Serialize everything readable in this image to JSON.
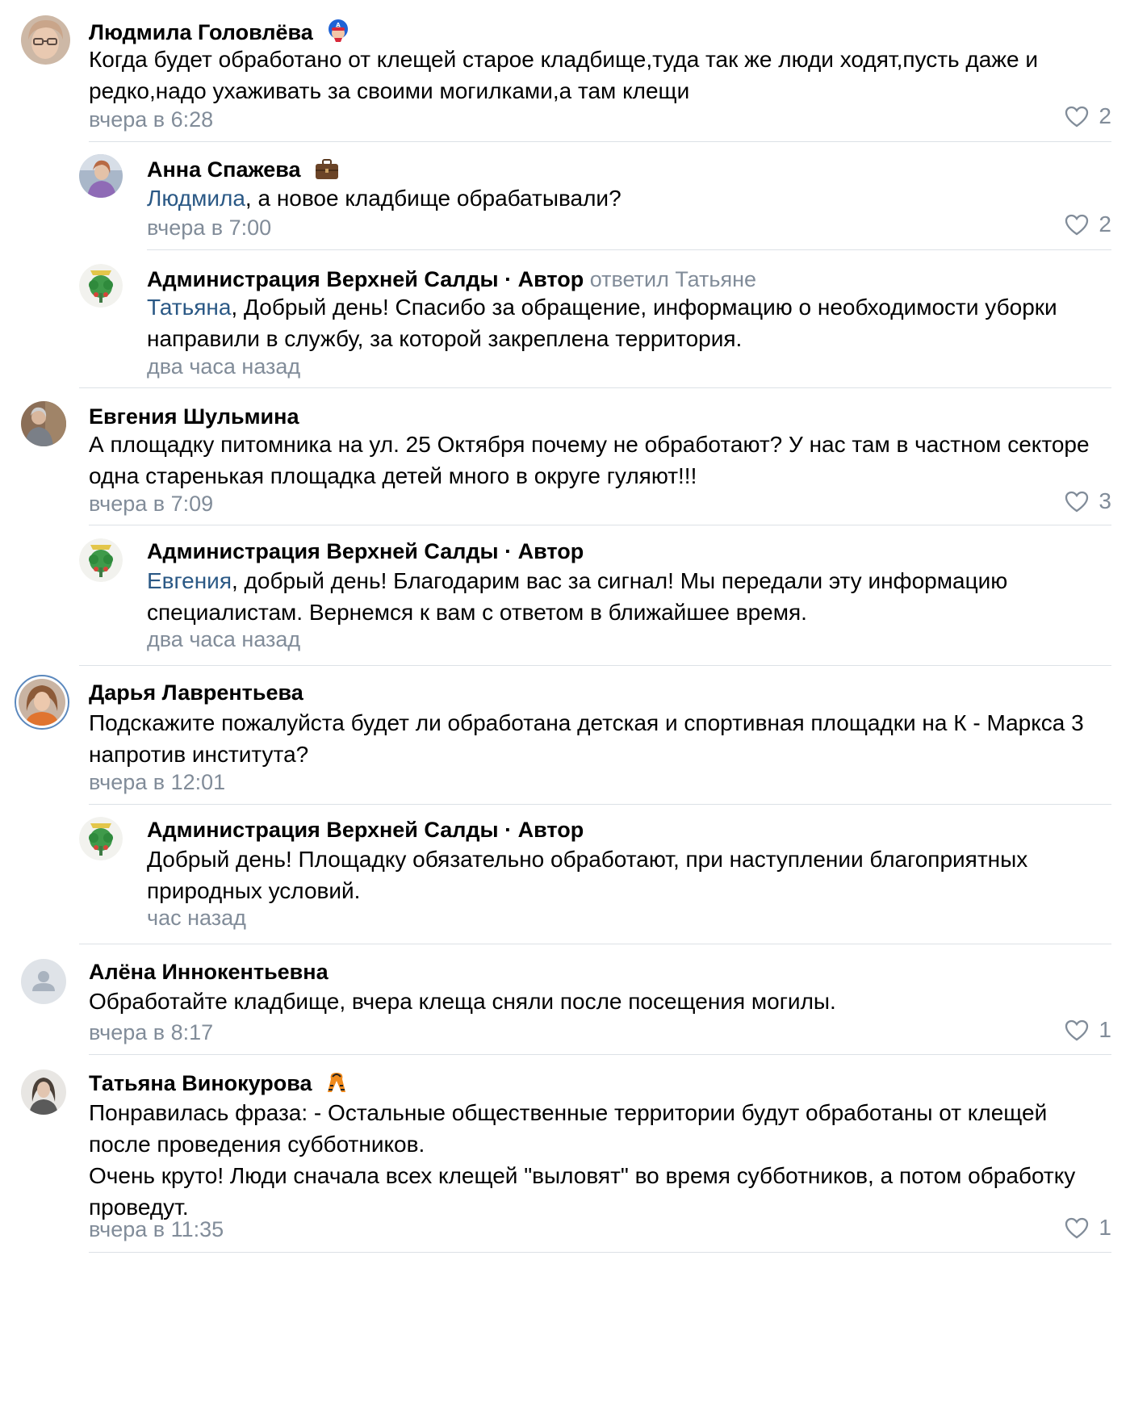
{
  "colors": {
    "text": "#000000",
    "muted": "#818c99",
    "link": "#2a5885",
    "divider": "#dce1e6",
    "avatar_ring": "#5b88bd"
  },
  "comments": [
    {
      "author": "Людмила Головлёва",
      "badge": "captain-shield-emoji-icon",
      "text": "Когда будет обработано от клещей старое кладбище,туда так же люди ходят,пусть даже и редко,надо ухаживать за своими могилками,а там клещи",
      "time": "вчера в 6:28",
      "likes": "2",
      "replies": [
        {
          "author": "Анна Спажева",
          "badge": "briefcase-emoji-icon",
          "mention": "Людмила",
          "text": ", а новое кладбище обрабатывали?",
          "time": "вчера в 7:00",
          "likes": "2"
        },
        {
          "author": "Администрация Верхней Салды · Автор",
          "reply_to": "ответил Татьяне",
          "mention": "Татьяна",
          "text": ", Добрый день! Спасибо за обращение, информацию о необходимости уборки направили в службу, за которой закреплена территория.",
          "time": "два часа назад"
        }
      ]
    },
    {
      "author": "Евгения Шульмина",
      "text": "А площадку питомника на ул. 25 Октября почему не обработают? У нас там в частном секторе одна старенькая площадка детей много в округе гуляют!!!",
      "time": "вчера в 7:09",
      "likes": "3",
      "replies": [
        {
          "author": "Администрация Верхней Салды · Автор",
          "mention": "Евгения",
          "text": ", добрый день! Благодарим вас за сигнал! Мы передали эту информацию специалистам. Вернемся к вам с ответом в ближайшее время.",
          "time": "два часа назад"
        }
      ]
    },
    {
      "author": "Дарья Лаврентьева",
      "text": "Подскажите пожалуйста будет ли обработана детская и спортивная площадки на К - Маркса 3 напротив института?",
      "time": "вчера в 12:01",
      "replies": [
        {
          "author": "Администрация Верхней Салды · Автор",
          "text": "Добрый день! Площадку обязательно обработают, при наступлении благоприятных природных условий.",
          "time": "час назад"
        }
      ]
    },
    {
      "author": "Алёна Иннокентьевна",
      "text": "Обработайте кладбище, вчера клеща сняли после посещения могилы.",
      "time": "вчера в 8:17",
      "likes": "1"
    },
    {
      "author": "Татьяна Винокурова",
      "badge": "st-george-ribbon-emoji-icon",
      "text": "Понравилась фраза: - Остальные общественные территории будут обработаны от клещей после проведения субботников.\nОчень круто! Люди сначала всех клещей \"выловят\" во время субботников, а потом обработку проведут.",
      "time": "вчера в 11:35",
      "likes": "1"
    }
  ]
}
